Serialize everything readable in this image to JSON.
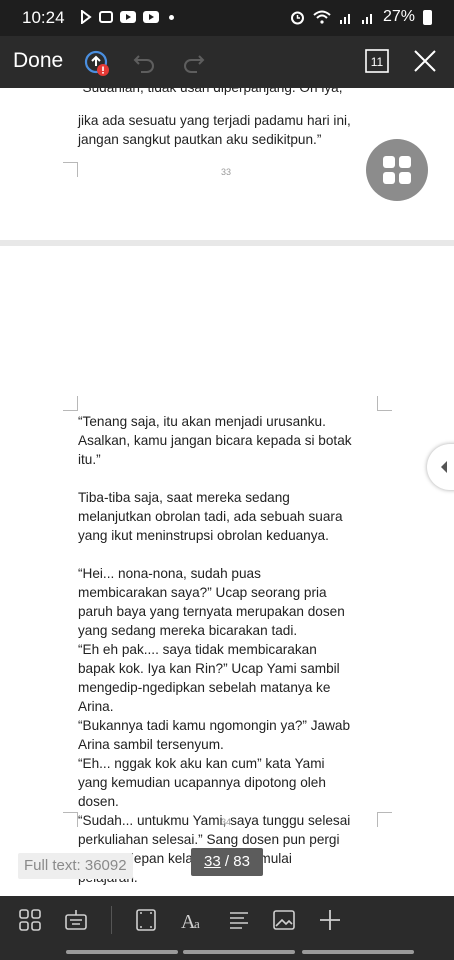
{
  "status_bar": {
    "time": "10:24",
    "battery_percent": "27%"
  },
  "toolbar": {
    "done_label": "Done",
    "page_count_icon_label": "11"
  },
  "document": {
    "page33": {
      "partial_top_line": "“Sudahlah, tidak usah diperpanjang. Oh iya,",
      "lines": [
        "jika ada sesuatu yang terjadi padamu hari ini,",
        "jangan sangkut pautkan aku sedikitpun.”"
      ],
      "page_number": "33"
    },
    "page34": {
      "paragraphs": [
        [
          "“Tenang saja, itu akan menjadi urusanku.",
          "Asalkan, kamu jangan bicara kepada si botak",
          "itu.”"
        ],
        [
          "Tiba-tiba saja, saat mereka sedang",
          "melanjutkan obrolan tadi, ada sebuah suara",
          "yang ikut meninstrupsi obrolan keduanya."
        ],
        [
          "“Hei... nona-nona, sudah puas",
          "membicarakan saya?” Ucap seorang pria",
          "paruh baya yang ternyata merupakan dosen",
          "yang sedang mereka bicarakan tadi.",
          "“Eh eh pak.... saya tidak membicarakan",
          "bapak kok. Iya kan Rin?” Ucap Yami sambil",
          "mengedip-ngedipkan sebelah matanya ke",
          "Arina.",
          "“Bukannya tadi kamu ngomongin ya?” Jawab",
          "Arina sambil tersenyum.",
          "“Eh... nggak kok aku kan cum” kata Yami",
          "yang kemudian ucapannya dipotong oleh",
          "dosen.",
          "“Sudah... untukmu Yami, saya tunggu selesai",
          "perkuliahan selesai.” Sang dosen pun pergi",
          "menuju depan kelas untuk memulai",
          "pelajaran."
        ]
      ],
      "page_number": "34"
    }
  },
  "full_text_label": "Full text: 36092",
  "pager": {
    "current": "33",
    "separator": " / ",
    "total": "83"
  },
  "colors": {
    "status_bar": "#1e1e1e",
    "toolbar": "#2b2b2b",
    "fab": "#8c8c8c",
    "badge": "#5c5c5c",
    "accent_icon": "#4a8fe0",
    "alert": "#e53935"
  },
  "icons": [
    "screencast-icon",
    "app-icon",
    "youtube-icon",
    "youtube-icon",
    "alarm-icon",
    "wifi-icon",
    "signal-icon",
    "signal-icon",
    "battery-icon",
    "share-alert-icon",
    "undo-icon",
    "redo-icon",
    "page-count-icon",
    "close-icon",
    "grid-menu-icon",
    "chevron-left-icon",
    "thumbnails-icon",
    "keyboard-icon",
    "page-layout-icon",
    "font-size-icon",
    "paragraph-align-icon",
    "image-icon",
    "add-icon"
  ]
}
